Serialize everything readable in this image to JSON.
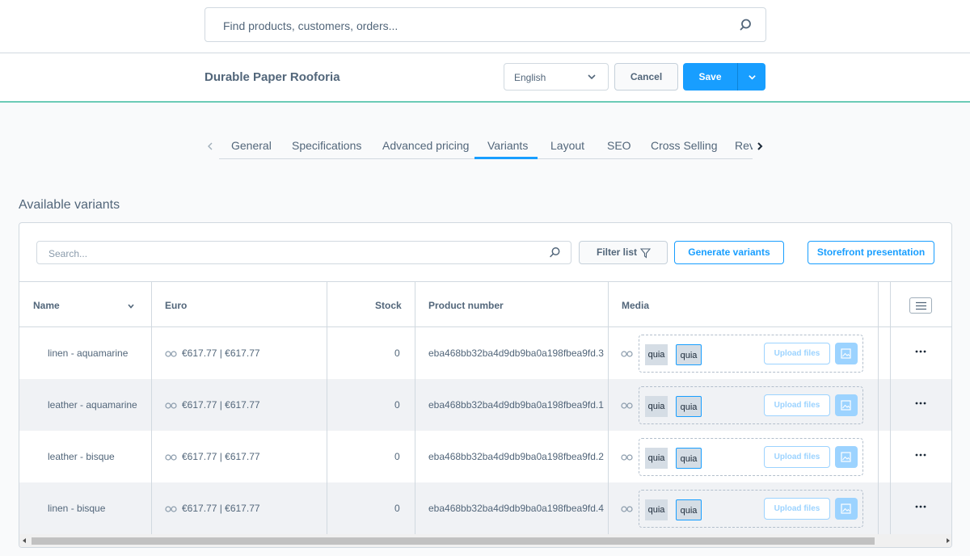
{
  "global_search": {
    "placeholder": "Find products, customers, orders...",
    "icon": "search-icon"
  },
  "header": {
    "product_title": "Durable Paper Rooforia",
    "language": "English",
    "cancel_label": "Cancel",
    "save_label": "Save"
  },
  "tabs": [
    "General",
    "Specifications",
    "Advanced pricing",
    "Variants",
    "Layout",
    "SEO",
    "Cross Selling",
    "Rev"
  ],
  "active_tab": "Variants",
  "section_title": "Available variants",
  "toolbar": {
    "search_placeholder": "Search...",
    "filter_label": "Filter list",
    "generate_label": "Generate variants",
    "storefront_label": "Storefront presentation"
  },
  "columns": {
    "name": "Name",
    "price": "Euro",
    "stock": "Stock",
    "product_number": "Product number",
    "media": "Media"
  },
  "rows": [
    {
      "name": "linen - aquamarine",
      "price": "€617.77 | €617.77",
      "stock": "0",
      "number": "eba468bb32ba4d9db9ba0a198fbea9fd.3",
      "media": [
        "quia",
        "quia"
      ],
      "upload": "Upload files"
    },
    {
      "name": "leather - aquamarine",
      "price": "€617.77 | €617.77",
      "stock": "0",
      "number": "eba468bb32ba4d9db9ba0a198fbea9fd.1",
      "media": [
        "quia",
        "quia"
      ],
      "upload": "Upload files"
    },
    {
      "name": "leather - bisque",
      "price": "€617.77 | €617.77",
      "stock": "0",
      "number": "eba468bb32ba4d9db9ba0a198fbea9fd.2",
      "media": [
        "quia",
        "quia"
      ],
      "upload": "Upload files"
    },
    {
      "name": "linen - bisque",
      "price": "€617.77 | €617.77",
      "stock": "0",
      "number": "eba468bb32ba4d9db9ba0a198fbea9fd.4",
      "media": [
        "quia",
        "quia"
      ],
      "upload": "Upload files"
    }
  ],
  "colors": {
    "accent": "#189eff",
    "header_border": "#6ccbb6",
    "text": "#52667a"
  }
}
